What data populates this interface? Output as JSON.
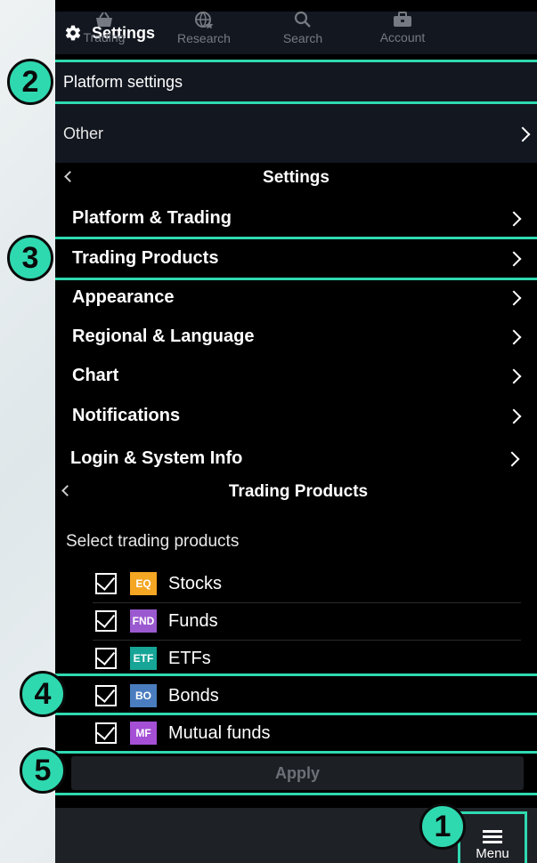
{
  "header": {
    "title": "Settings",
    "icon": "gear-icon"
  },
  "top_rows": {
    "platform_settings": "Platform settings",
    "other": "Other"
  },
  "settings_panel": {
    "title": "Settings",
    "items": [
      {
        "label": "Platform & Trading"
      },
      {
        "label": "Trading Products"
      },
      {
        "label": "Appearance"
      },
      {
        "label": "Regional & Language"
      },
      {
        "label": "Chart"
      },
      {
        "label": "Notifications"
      },
      {
        "label": "Login & System Info"
      }
    ]
  },
  "trading_products": {
    "title": "Trading Products",
    "subtitle": "Select trading products",
    "products": [
      {
        "badge": "EQ",
        "name": "Stocks",
        "color": "#f5a623",
        "checked": true
      },
      {
        "badge": "FND",
        "name": "Funds",
        "color": "#9b59d0",
        "checked": true
      },
      {
        "badge": "ETF",
        "name": "ETFs",
        "color": "#16a596",
        "checked": true
      },
      {
        "badge": "BO",
        "name": "Bonds",
        "color": "#4a7dbf",
        "checked": true
      },
      {
        "badge": "MF",
        "name": "Mutual funds",
        "color": "#a44fd6",
        "checked": true
      }
    ],
    "apply_label": "Apply"
  },
  "callouts": [
    "1",
    "2",
    "3",
    "4",
    "5"
  ],
  "bottom_nav": {
    "items": [
      {
        "label": "Trading",
        "icon": "basket-icon"
      },
      {
        "label": "Research",
        "icon": "globe-star-icon"
      },
      {
        "label": "Search",
        "icon": "search-icon"
      },
      {
        "label": "Account",
        "icon": "briefcase-icon"
      },
      {
        "label": "Menu",
        "icon": "hamburger-icon"
      }
    ]
  },
  "colors": {
    "accent": "#2fd9b0",
    "panel": "#000000",
    "header": "#131720"
  }
}
